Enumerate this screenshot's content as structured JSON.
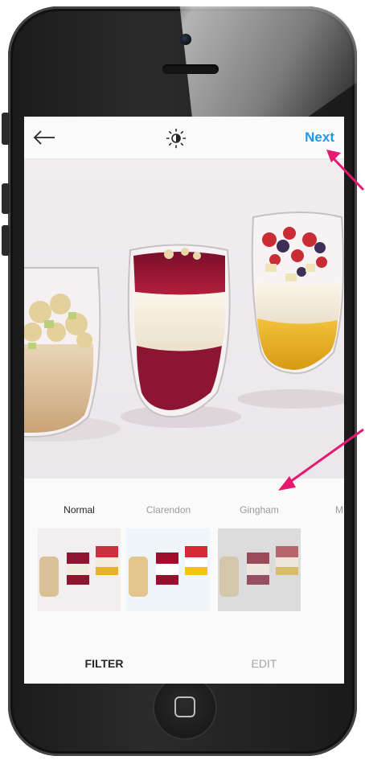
{
  "header": {
    "next_label": "Next"
  },
  "filters": [
    {
      "name": "Normal",
      "active": true
    },
    {
      "name": "Clarendon",
      "active": false
    },
    {
      "name": "Gingham",
      "active": false
    },
    {
      "name": "M",
      "active": false
    }
  ],
  "tabs": {
    "filter_label": "FILTER",
    "edit_label": "EDIT"
  },
  "colors": {
    "accent": "#1e98e8",
    "annotation": "#e6186f"
  },
  "icons": [
    "back-arrow-icon",
    "brightness-icon"
  ]
}
